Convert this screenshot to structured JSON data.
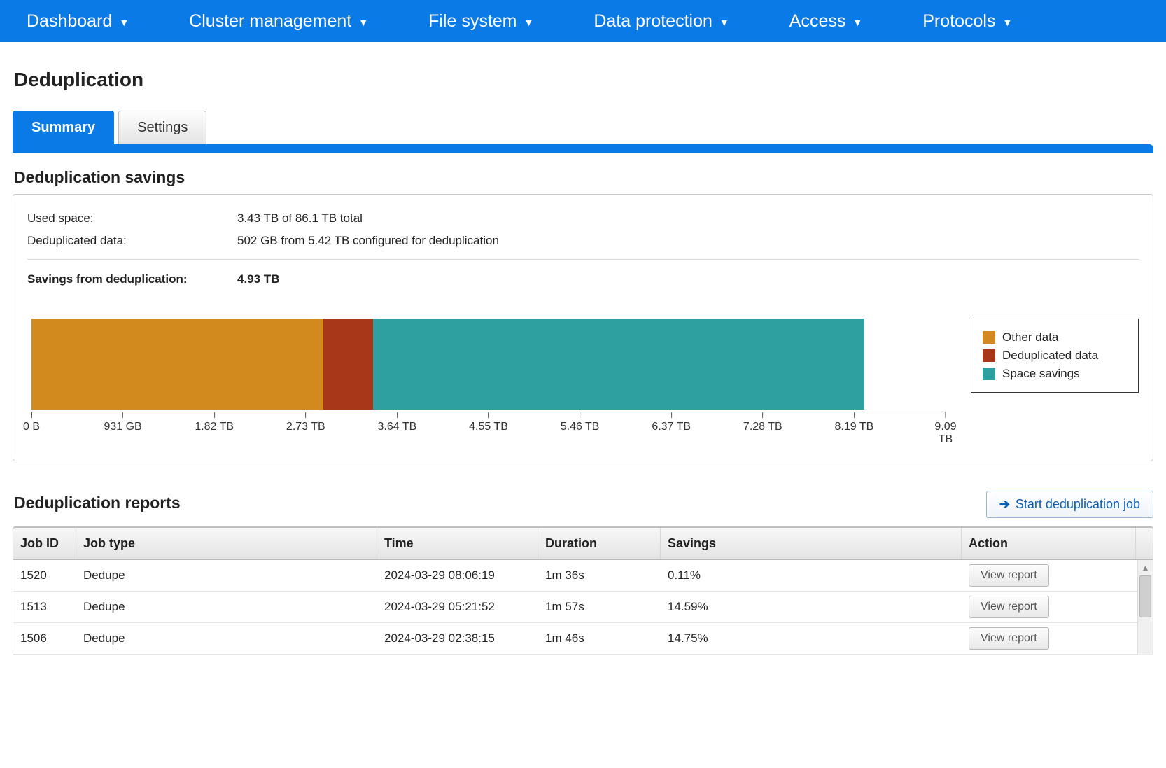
{
  "nav": {
    "items": [
      {
        "label": "Dashboard"
      },
      {
        "label": "Cluster management"
      },
      {
        "label": "File system"
      },
      {
        "label": "Data protection"
      },
      {
        "label": "Access"
      },
      {
        "label": "Protocols"
      }
    ]
  },
  "page": {
    "title": "Deduplication",
    "tabs": [
      {
        "label": "Summary",
        "active": true
      },
      {
        "label": "Settings",
        "active": false
      }
    ]
  },
  "savings": {
    "title": "Deduplication savings",
    "used_space_label": "Used space:",
    "used_space_value": "3.43 TB of 86.1 TB total",
    "dedup_data_label": "Deduplicated data:",
    "dedup_data_value": "502 GB from 5.42 TB configured for deduplication",
    "savings_label": "Savings from deduplication:",
    "savings_value": "4.93 TB"
  },
  "chart_data": {
    "type": "bar",
    "orientation": "horizontal-stacked",
    "x_unit": "TB",
    "axis_ticks": [
      "0 B",
      "931 GB",
      "1.82 TB",
      "2.73 TB",
      "3.64 TB",
      "4.55 TB",
      "5.46 TB",
      "6.37 TB",
      "7.28 TB",
      "8.19 TB",
      "9.09 TB"
    ],
    "axis_max_tb": 9.09,
    "bar_max_tb": 8.36,
    "series": [
      {
        "name": "Other data",
        "value_tb": 2.93,
        "color": "#d28a1f"
      },
      {
        "name": "Deduplicated data",
        "value_tb": 0.5,
        "color": "#a8371a"
      },
      {
        "name": "Space savings",
        "value_tb": 4.93,
        "color": "#2fa0a0"
      }
    ],
    "legend": [
      "Other data",
      "Deduplicated data",
      "Space savings"
    ]
  },
  "reports": {
    "title": "Deduplication reports",
    "start_button": "Start deduplication job",
    "columns": {
      "id": "Job ID",
      "type": "Job type",
      "time": "Time",
      "dur": "Duration",
      "sav": "Savings",
      "act": "Action"
    },
    "view_label": "View report",
    "rows": [
      {
        "id": "1520",
        "type": "Dedupe",
        "time": "2024-03-29 08:06:19",
        "dur": "1m 36s",
        "sav": "0.11%"
      },
      {
        "id": "1513",
        "type": "Dedupe",
        "time": "2024-03-29 05:21:52",
        "dur": "1m 57s",
        "sav": "14.59%"
      },
      {
        "id": "1506",
        "type": "Dedupe",
        "time": "2024-03-29 02:38:15",
        "dur": "1m 46s",
        "sav": "14.75%"
      }
    ]
  }
}
